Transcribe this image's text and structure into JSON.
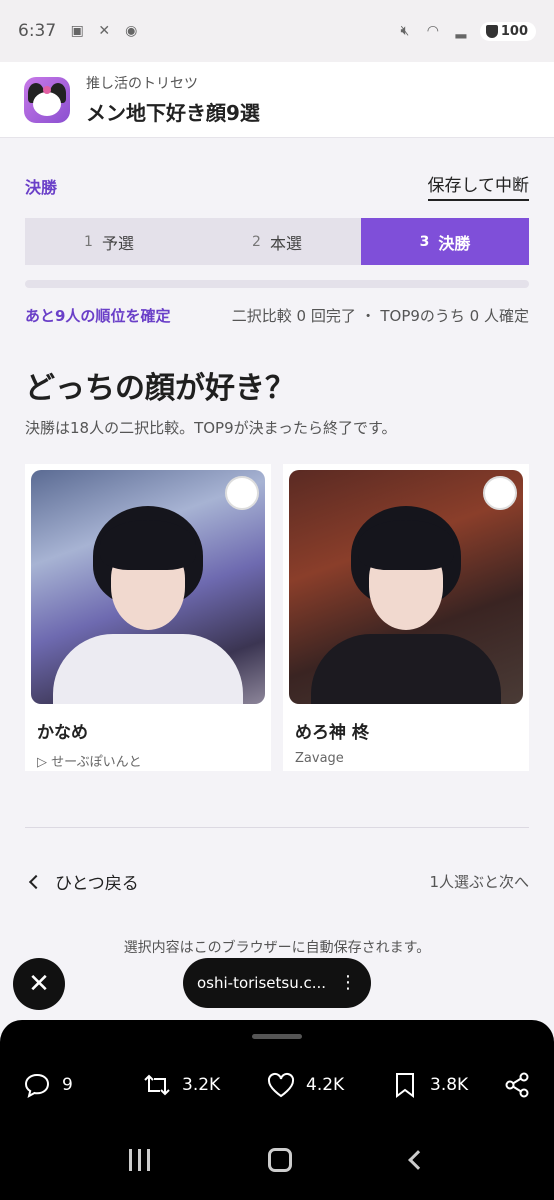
{
  "statusbar": {
    "time": "6:37",
    "battery": "100"
  },
  "app": {
    "subtitle": "推し活のトリセツ",
    "title": "メン地下好き顔9選"
  },
  "phase": {
    "label": "決勝",
    "save_button": "保存して中断"
  },
  "steps": [
    {
      "num": "1",
      "label": "予選"
    },
    {
      "num": "2",
      "label": "本選"
    },
    {
      "num": "3",
      "label": "決勝"
    }
  ],
  "status": {
    "remaining": "あと9人の順位を確定",
    "stats": "二択比較 0 回完了 ・ TOP9のうち 0 人確定"
  },
  "question": "どっちの顔が好き？",
  "description": "決勝は18人の二択比較。TOP9が決まったら終了です。",
  "candidates": [
    {
      "name": "かなめ",
      "group": "▷ せーぶぽいんと"
    },
    {
      "name": "めろ神 柊",
      "group": "Zavage"
    }
  ],
  "nav": {
    "back": "ひとつ戻る",
    "next_hint": "1人選ぶと次へ"
  },
  "autosave_note": "選択内容はこのブラウザーに自動保存されます。",
  "browser": {
    "url": "oshi-torisetsu.c..."
  },
  "tweet_actions": {
    "replies": "9",
    "reposts": "3.2K",
    "likes": "4.2K",
    "bookmarks": "3.8K"
  }
}
